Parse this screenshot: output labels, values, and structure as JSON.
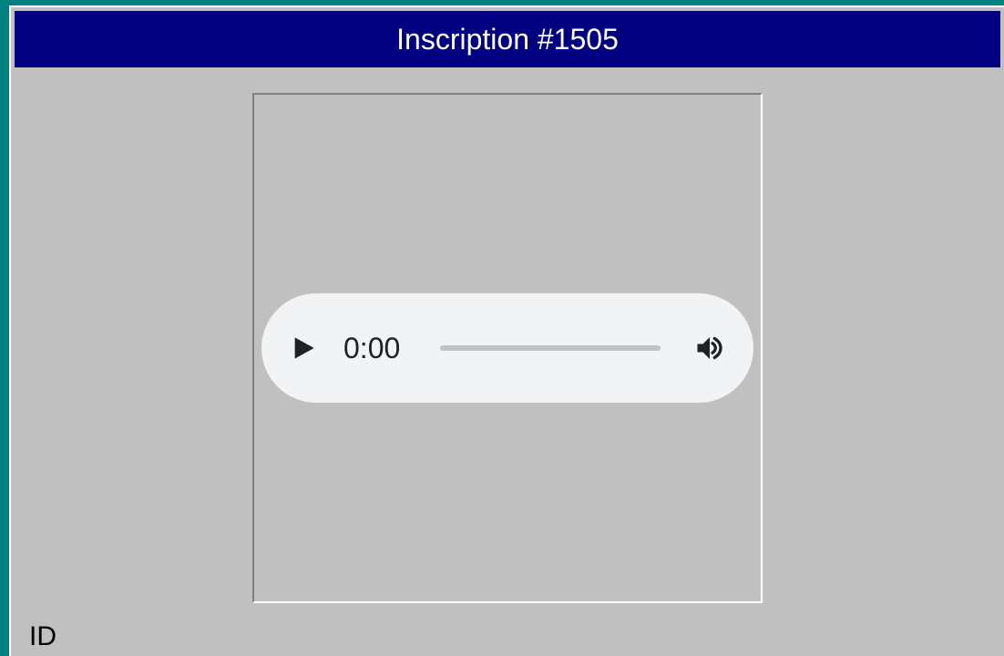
{
  "title": "Inscription #1505",
  "player": {
    "current_time": "0:00"
  },
  "label": {
    "id": "ID"
  }
}
